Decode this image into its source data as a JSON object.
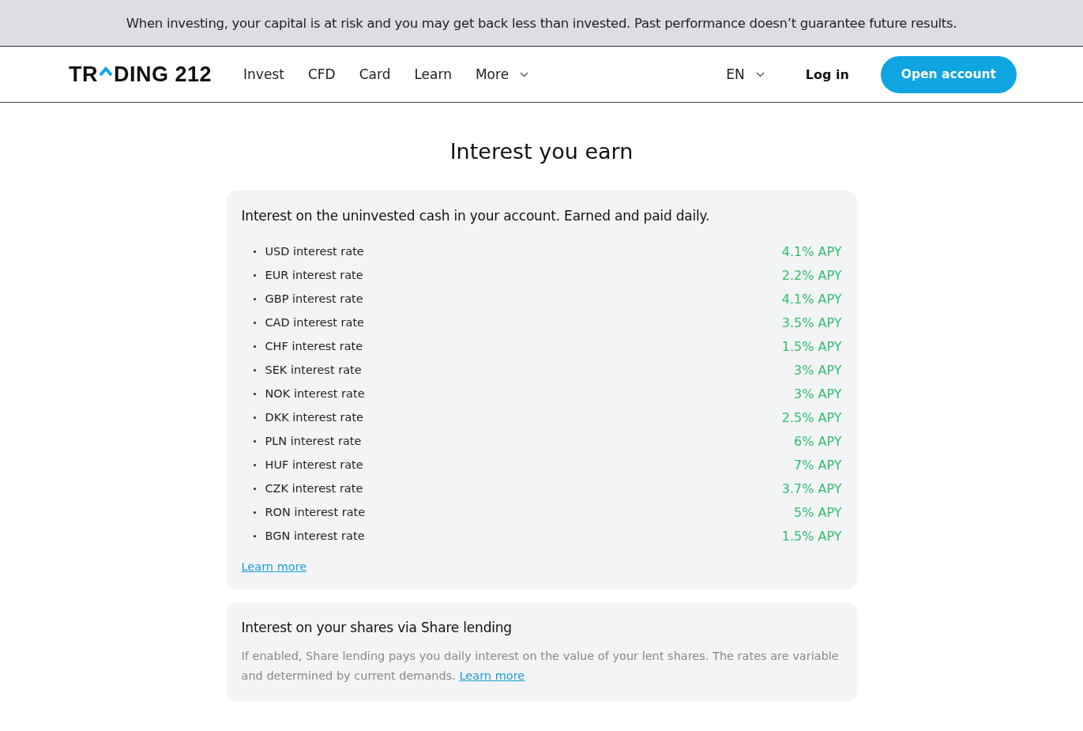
{
  "risk_banner": "When investing, your capital is at risk and you may get back less than invested. Past performance doesn’t guarantee future results.",
  "logo": {
    "before": "TR",
    "after": "DING 212"
  },
  "nav": [
    {
      "label": "Invest",
      "dropdown": false
    },
    {
      "label": "CFD",
      "dropdown": false
    },
    {
      "label": "Card",
      "dropdown": false
    },
    {
      "label": "Learn",
      "dropdown": false
    },
    {
      "label": "More",
      "dropdown": true
    }
  ],
  "language": "EN",
  "login": "Log in",
  "open_account": "Open account",
  "title": "Interest you earn",
  "cash_card": {
    "heading": "Interest on the uninvested cash in your account. Earned and paid daily.",
    "rates": [
      {
        "label": "USD interest rate",
        "value": "4.1% APY"
      },
      {
        "label": "EUR interest rate",
        "value": "2.2% APY"
      },
      {
        "label": "GBP interest rate",
        "value": "4.1% APY"
      },
      {
        "label": "CAD interest rate",
        "value": "3.5% APY"
      },
      {
        "label": "CHF interest rate",
        "value": "1.5% APY"
      },
      {
        "label": "SEK interest rate",
        "value": "3% APY"
      },
      {
        "label": "NOK interest rate",
        "value": "3% APY"
      },
      {
        "label": "DKK interest rate",
        "value": "2.5% APY"
      },
      {
        "label": "PLN interest rate",
        "value": "6% APY"
      },
      {
        "label": "HUF interest rate",
        "value": "7% APY"
      },
      {
        "label": "CZK interest rate",
        "value": "3.7% APY"
      },
      {
        "label": "RON interest rate",
        "value": "5% APY"
      },
      {
        "label": "BGN interest rate",
        "value": "1.5% APY"
      }
    ],
    "link": "Learn more"
  },
  "shares_card": {
    "heading": "Interest on your shares via Share lending",
    "text": "If enabled, Share lending pays you daily interest on the value of your lent shares. The rates are variable and determined by current demands.",
    "link": "Learn more"
  }
}
